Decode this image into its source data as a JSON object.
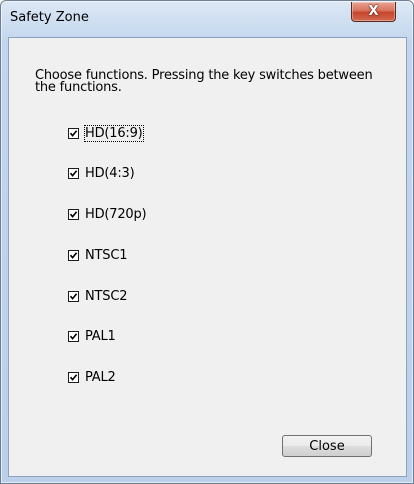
{
  "window": {
    "title": "Safety Zone",
    "close_glyph": "X"
  },
  "dialog": {
    "instructions": "Choose functions. Pressing the key switches between the functions.",
    "options": [
      {
        "label": "HD(16:9)",
        "checked": true,
        "focused": true
      },
      {
        "label": "HD(4:3)",
        "checked": true
      },
      {
        "label": "HD(720p)",
        "checked": true
      },
      {
        "label": "NTSC1",
        "checked": true
      },
      {
        "label": "NTSC2",
        "checked": true
      },
      {
        "label": "PAL1",
        "checked": true
      },
      {
        "label": "PAL2",
        "checked": true
      }
    ],
    "close_label": "Close"
  },
  "colors": {
    "titlebar": "#c9dbef",
    "close_button_red": "#c4452c",
    "client_background": "#f0f0f0"
  }
}
